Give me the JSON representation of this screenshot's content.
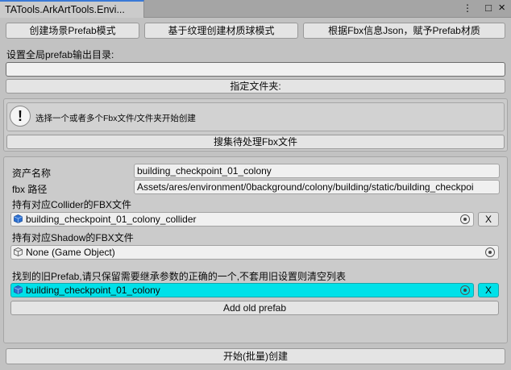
{
  "tab": {
    "title": "TATools.ArkArtTools.Envi..."
  },
  "window_icons": {
    "menu": "⋮",
    "maximize": "□",
    "close": "×"
  },
  "top_buttons": [
    "创建场景Prefab模式",
    "基于纹理创建材质球模式",
    "根据Fbx信息Json，赋予Prefab材质"
  ],
  "output_dir": {
    "label": "设置全局prefab输出目录:",
    "value": "",
    "button": "指定文件夹:"
  },
  "info": {
    "icon": "!",
    "message": "选择一个或者多个Fbx文件/文件夹开始创建",
    "search_button": "搜集待处理Fbx文件"
  },
  "asset": {
    "name_label": "资产名称",
    "name_value": "building_checkpoint_01_colony",
    "path_label": "fbx 路径",
    "path_value": "Assets/ares/environment/0background/colony/building/static/building_checkpoi",
    "collider_label": "持有对应Collider的FBX文件",
    "collider_value": "building_checkpoint_01_colony_collider",
    "shadow_label": "持有对应Shadow的FBX文件",
    "shadow_value": "None (Game Object)",
    "old_prefab_label": "找到的旧Prefab,请只保留需要继承参数的正确的一个,不套用旧设置则清空列表",
    "old_prefab_value": "building_checkpoint_01_colony",
    "clear_label": "X",
    "add_old_prefab": "Add old prefab"
  },
  "start_button": "开始(批量)创建",
  "colors": {
    "selected_field": "#00e1e9",
    "tab_accent": "#3a79d6",
    "cube_blue": "#2b6fd1"
  }
}
